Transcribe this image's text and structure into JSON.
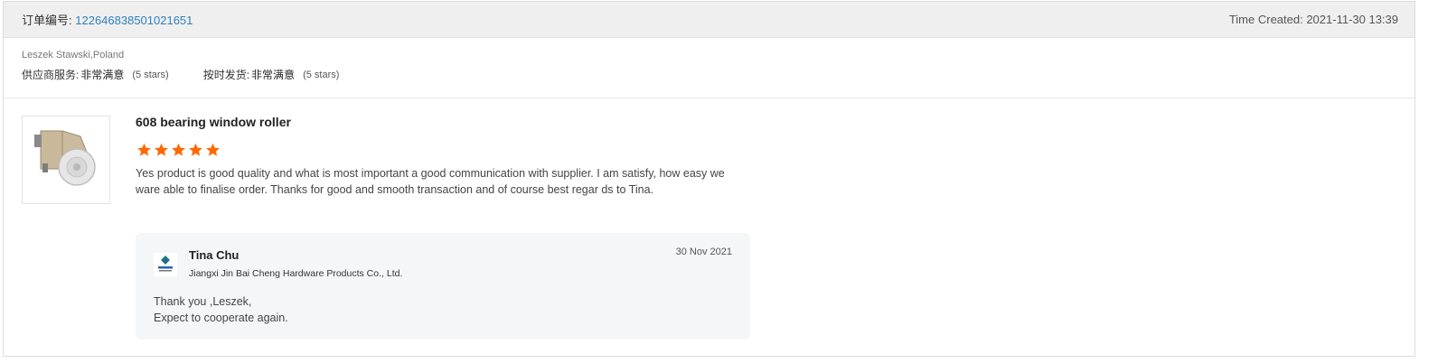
{
  "order": {
    "label": "订单编号:",
    "number": "122646838501021651",
    "created": "Time Created: 2021-11-30 13:39"
  },
  "buyer": {
    "name_location": "Leszek Stawski,Poland",
    "ratings": [
      {
        "label": "供应商服务:",
        "value": "非常满意",
        "stars": "(5 stars)"
      },
      {
        "label": "按时发货:",
        "value": "非常满意",
        "stars": "(5 stars)"
      }
    ]
  },
  "review": {
    "product_title": "608 bearing window roller",
    "rating": 5,
    "star_color": "#ff6a00",
    "text": "Yes product is good quality and what is most important a good communication with supplier. I am satisfy, how easy we ware able to finalise order. Thanks for good and smooth transaction and of course best regar ds to Tina."
  },
  "reply": {
    "name": "Tina Chu",
    "company": "Jiangxi Jin Bai Cheng Hardware Products Co., Ltd.",
    "date": "30 Nov 2021",
    "message_line1": "Thank you ,Leszek,",
    "message_line2": "Expect to cooperate again."
  },
  "colors": {
    "link": "#2f7fc1",
    "header_bg": "#efefef",
    "reply_bg": "#f5f6f7"
  }
}
